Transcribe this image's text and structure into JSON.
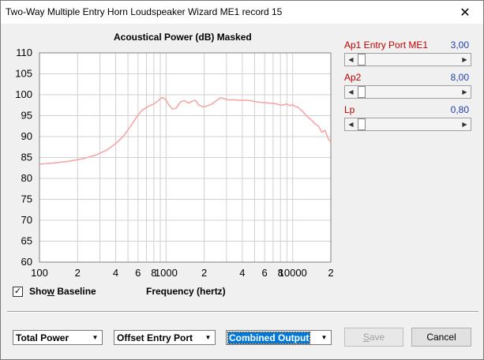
{
  "window": {
    "title": "Two-Way Multiple Entry Horn Loudspeaker Wizard   ME1 record 15",
    "close_glyph": "✕"
  },
  "chart_title": "Acoustical Power (dB)   Masked",
  "show_baseline": {
    "label_pre": "Sho",
    "label_u": "w",
    "label_post": " Baseline",
    "checked": true,
    "check_glyph": "✓"
  },
  "params": [
    {
      "label": "Ap1  Entry Port  ME1",
      "value": "3,00",
      "position": 0.0
    },
    {
      "label": "Ap2",
      "value": "8,00",
      "position": 0.0
    },
    {
      "label": "Lp",
      "value": "0,80",
      "position": 0.0
    }
  ],
  "combos": [
    {
      "value": "Total Power"
    },
    {
      "value": "Offset Entry Port"
    },
    {
      "value": "Combined Output"
    }
  ],
  "buttons": {
    "save_pre": "",
    "save_u": "S",
    "save_post": "ave",
    "cancel": "Cancel"
  },
  "colors": {
    "curve": "#f4a8a8",
    "grid": "#d0d0d0",
    "label_red": "#c00000",
    "value_blue": "#1f3fae"
  },
  "chart_data": {
    "type": "line",
    "title": "Acoustical Power (dB)   Masked",
    "xlabel": "Frequency (hertz)",
    "ylabel": "",
    "x_scale": "log",
    "xlim": [
      100,
      20000
    ],
    "ylim": [
      60,
      110
    ],
    "grid": true,
    "y_ticks": [
      110,
      105,
      100,
      95,
      90,
      85,
      80,
      75,
      70,
      65,
      60
    ],
    "x_tick_labels": [
      {
        "x": 100,
        "label": "100"
      },
      {
        "x": 200,
        "label": "2"
      },
      {
        "x": 400,
        "label": "4"
      },
      {
        "x": 600,
        "label": "6"
      },
      {
        "x": 800,
        "label": "8"
      },
      {
        "x": 1000,
        "label": "1000"
      },
      {
        "x": 2000,
        "label": "2"
      },
      {
        "x": 4000,
        "label": "4"
      },
      {
        "x": 6000,
        "label": "6"
      },
      {
        "x": 8000,
        "label": "8"
      },
      {
        "x": 10000,
        "label": "10000"
      },
      {
        "x": 20000,
        "label": "2"
      }
    ],
    "series": [
      {
        "x": [
          100,
          130,
          170,
          220,
          280,
          340,
          400,
          460,
          520,
          580,
          640,
          720,
          800,
          860,
          920,
          980,
          1040,
          1120,
          1200,
          1300,
          1400,
          1500,
          1600,
          1700,
          1800,
          1950,
          2100,
          2300,
          2500,
          2700,
          2900,
          3100,
          3400,
          3800,
          4200,
          4600,
          5000,
          5500,
          6000,
          6500,
          7000,
          7500,
          8000,
          8500,
          9000,
          9500,
          10000,
          10500,
          11000,
          12000,
          13000,
          14000,
          15000,
          16000,
          17000,
          18000,
          19000,
          20000
        ],
        "y": [
          83.4,
          83.7,
          84.1,
          84.7,
          85.6,
          86.8,
          88.3,
          90.1,
          92.3,
          94.5,
          96.2,
          97.2,
          97.8,
          98.5,
          99.3,
          99.1,
          97.8,
          96.6,
          96.8,
          98.3,
          98.6,
          98.0,
          98.4,
          98.7,
          97.6,
          97.1,
          97.3,
          97.8,
          98.6,
          99.3,
          99.0,
          98.8,
          98.8,
          98.7,
          98.7,
          98.6,
          98.4,
          98.2,
          98.1,
          98.0,
          97.9,
          97.8,
          97.5,
          97.6,
          97.8,
          97.4,
          97.6,
          97.2,
          97.0,
          96.0,
          94.8,
          94.0,
          93.0,
          92.5,
          91.0,
          91.5,
          89.6,
          88.6
        ]
      }
    ]
  }
}
